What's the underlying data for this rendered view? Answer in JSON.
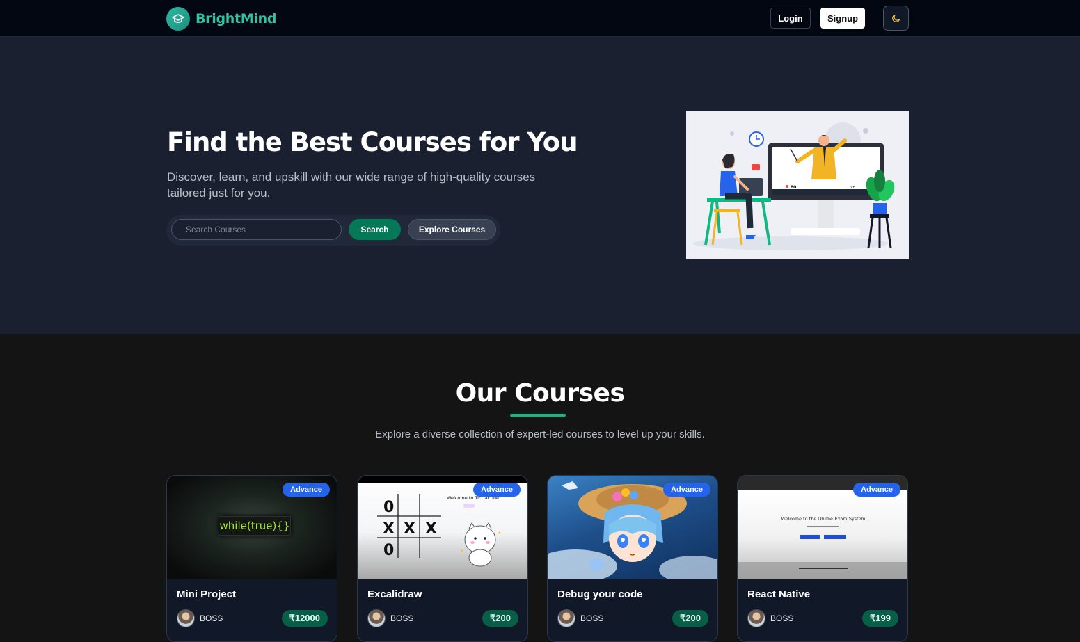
{
  "brand": {
    "name": "BrightMind",
    "logo_icon": "graduation-cap-icon"
  },
  "nav": {
    "login_label": "Login",
    "signup_label": "Signup",
    "theme_icon": "moon-icon"
  },
  "hero": {
    "title": "Find the Best Courses for You",
    "subtitle": "Discover, learn, and upskill with our wide range of high-quality courses tailored just for you.",
    "search_placeholder": "Search Courses",
    "search_label": "Search",
    "explore_label": "Explore Courses",
    "illustration": {
      "screen_stat": "80",
      "live_label": "LIVE"
    }
  },
  "courses": {
    "title": "Our Courses",
    "subtitle": "Explore a diverse collection of expert-led courses to level up your skills.",
    "items": [
      {
        "title": "Mini Project",
        "level": "Advance",
        "author": "BOSS",
        "price": "₹12000",
        "thumb_text": "while(true){}"
      },
      {
        "title": "Excalidraw",
        "level": "Advance",
        "author": "BOSS",
        "price": "₹200",
        "thumb_text": "Welcome to Tic Tac Toe"
      },
      {
        "title": "Debug your code",
        "level": "Advance",
        "author": "BOSS",
        "price": "₹200"
      },
      {
        "title": "React Native",
        "level": "Advance",
        "author": "BOSS",
        "price": "₹199",
        "thumb_text": "Welcome to the Online Exam System"
      }
    ]
  },
  "colors": {
    "accent": "#10b981",
    "brand": "#2ec4a0",
    "badge": "#2563eb",
    "price_bg": "#065f46"
  }
}
